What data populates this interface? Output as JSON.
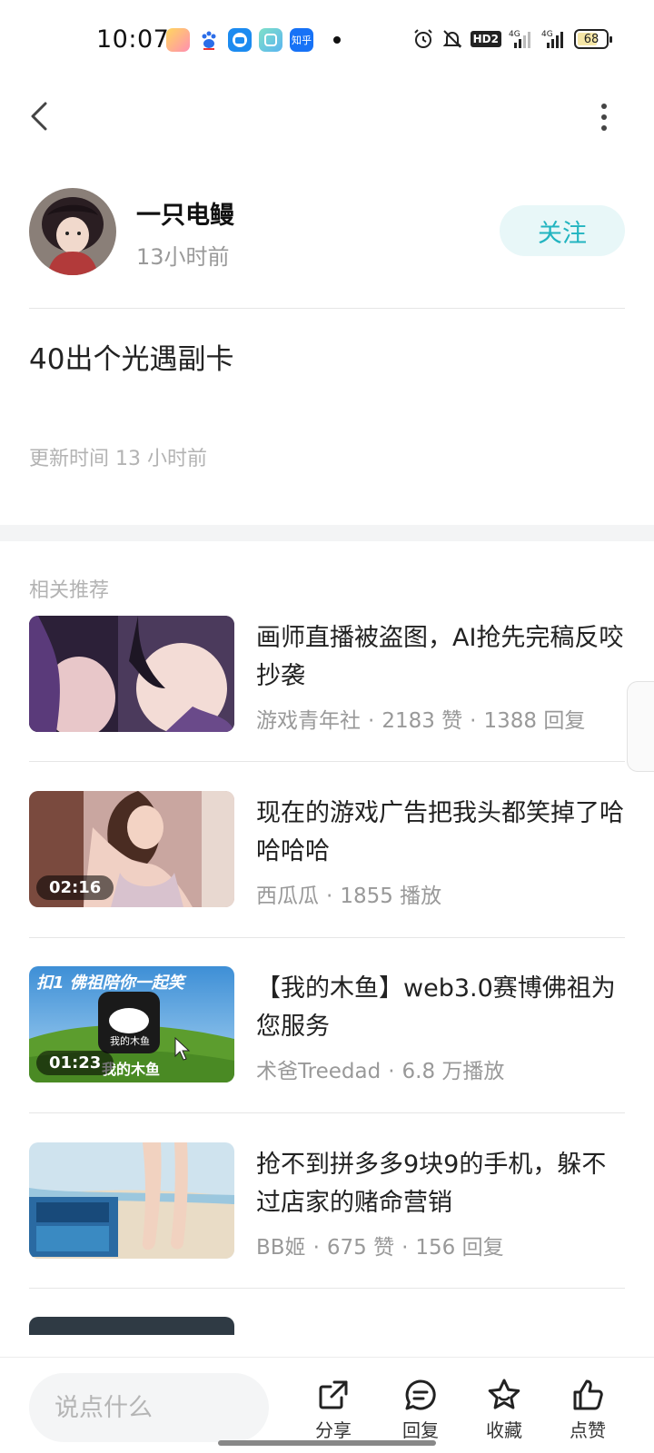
{
  "status_bar": {
    "time": "10:07",
    "battery": "68",
    "app_icons": [
      "photos-app-icon",
      "baidu-app-icon",
      "bilibili-app-icon",
      "notes-app-icon",
      "zhihu-app-icon"
    ],
    "right_icons": [
      "alarm-icon",
      "mute-bell-icon",
      "hd-icon",
      "signal-4g-icon",
      "signal-4g-icon",
      "battery-icon"
    ]
  },
  "nav": {
    "back_icon": "chevron-left-icon",
    "more_icon": "more-vertical-icon"
  },
  "author": {
    "name": "一只电鳗",
    "time": "13小时前",
    "follow_label": "关注"
  },
  "post": {
    "title": "40出个光遇副卡",
    "update_time": "更新时间 13 小时前"
  },
  "recommend": {
    "label": "相关推荐",
    "items": [
      {
        "title": "画师直播被盗图，AI抢先完稿反咬抄袭",
        "source": "游戏青年社",
        "stat1": "2183 赞",
        "stat2": "1388 回复",
        "duration": ""
      },
      {
        "title": "现在的游戏广告把我头都笑掉了哈哈哈哈",
        "source": "西瓜瓜",
        "stat1": "1855 播放",
        "stat2": "",
        "duration": "02:16"
      },
      {
        "title": "【我的木鱼】web3.0赛博佛祖为您服务",
        "source": "术爸Treedad",
        "stat1": "6.8 万播放",
        "stat2": "",
        "duration": "01:23",
        "thumb_text_top": "扣1 佛祖陪你一起笑",
        "thumb_text_icon": "我的木鱼",
        "thumb_text_bottom": "我的木鱼"
      },
      {
        "title": "抢不到拼多多9块9的手机，躲不过店家的赌命营销",
        "source": "BB姬",
        "stat1": "675 赞",
        "stat2": "156 回复",
        "duration": ""
      }
    ]
  },
  "bottom": {
    "input_placeholder": "说点什么",
    "share_label": "分享",
    "reply_label": "回复",
    "collect_label": "收藏",
    "like_label": "点赞"
  },
  "colors": {
    "accent": "#22b4c0",
    "follow_bg": "#e8f7f8"
  }
}
